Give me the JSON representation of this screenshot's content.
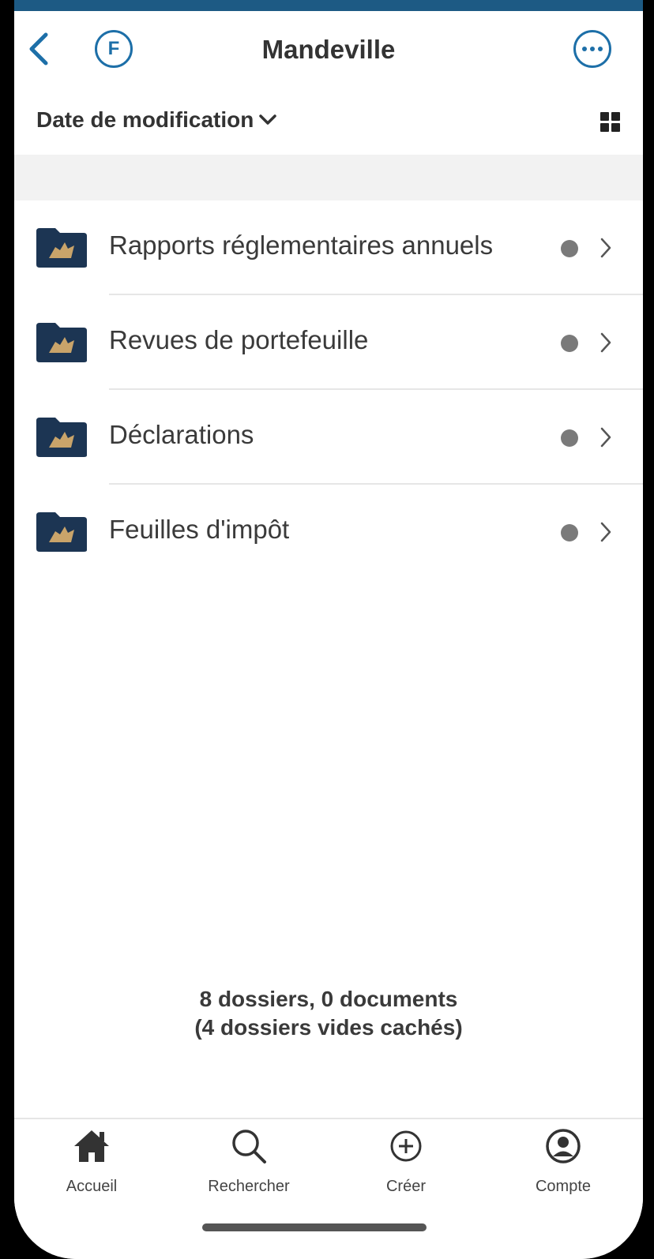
{
  "header": {
    "title": "Mandeville",
    "avatar_letter": "F"
  },
  "sortbar": {
    "sort_label": "Date de modification"
  },
  "folders": [
    {
      "label": "Rapports réglementaires annuels"
    },
    {
      "label": "Revues de portefeuille"
    },
    {
      "label": "Déclarations"
    },
    {
      "label": "Feuilles d'impôt"
    }
  ],
  "summary": {
    "line1": "8 dossiers, 0 documents",
    "line2": "(4 dossiers vides cachés)"
  },
  "tabs": [
    {
      "label": "Accueil",
      "icon": "home-icon"
    },
    {
      "label": "Rechercher",
      "icon": "search-icon"
    },
    {
      "label": "Créer",
      "icon": "plus-circle-icon"
    },
    {
      "label": "Compte",
      "icon": "account-icon"
    }
  ],
  "colors": {
    "accent": "#1d6fa8",
    "folder": "#1c3553",
    "folder_emblem": "#c9a46a",
    "status_dot": "#7a7a7a"
  }
}
